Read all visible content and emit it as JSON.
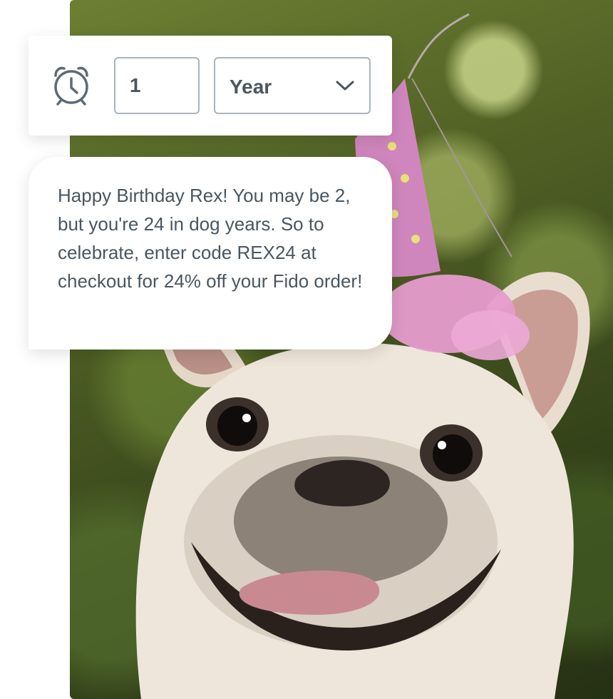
{
  "reminder": {
    "icon": "alarm-clock-icon",
    "quantity_value": "1",
    "unit_selected": "Year",
    "unit_dropdown_icon": "chevron-down-icon"
  },
  "message": {
    "text": "Happy Birthday Rex! You may be 2, but you're 24 in dog years. So to celebrate, enter code REX24 at checkout for 24% off your Fido order!"
  },
  "photo": {
    "subject": "french-bulldog-party-hat-photo"
  },
  "colors": {
    "text": "#4a5660",
    "field_border": "#a9b5be",
    "icon_stroke": "#5f6b74",
    "card_background": "#ffffff"
  }
}
